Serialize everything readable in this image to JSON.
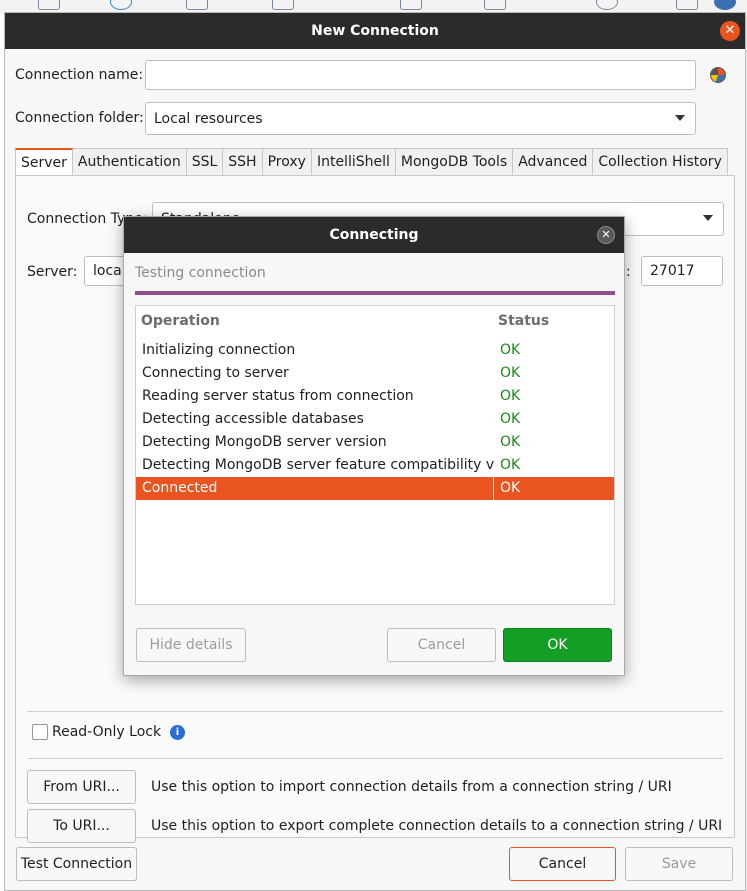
{
  "window": {
    "title": "New Connection"
  },
  "form": {
    "connection_name_label": "Connection name:",
    "connection_name_value": "",
    "connection_folder_label": "Connection folder:",
    "connection_folder_value": "Local resources"
  },
  "tabs": [
    {
      "label": "Server",
      "active": true
    },
    {
      "label": "Authentication"
    },
    {
      "label": "SSL"
    },
    {
      "label": "SSH"
    },
    {
      "label": "Proxy"
    },
    {
      "label": "IntelliShell"
    },
    {
      "label": "MongoDB Tools"
    },
    {
      "label": "Advanced"
    },
    {
      "label": "Collection History"
    }
  ],
  "server_tab": {
    "connection_type_label": "Connection Type:",
    "connection_type_value": "Standalone",
    "server_label": "Server:",
    "server_value_visible": "local",
    "port_colon": ":",
    "port_value": "27017",
    "read_only_lock_label": "Read-Only Lock",
    "from_uri_button": "From URI...",
    "from_uri_desc": "Use this option to import connection details from a connection string / URI",
    "to_uri_button": "To URI...",
    "to_uri_desc": "Use this option to export complete connection details to a connection string / URI"
  },
  "footer": {
    "test_connection": "Test Connection",
    "cancel": "Cancel",
    "save": "Save"
  },
  "connecting_dialog": {
    "title": "Connecting",
    "status": "Testing connection",
    "progress": 1.0,
    "columns": [
      "Operation",
      "Status"
    ],
    "rows": [
      {
        "operation": "Initializing connection",
        "status": "OK"
      },
      {
        "operation": "Connecting to server",
        "status": "OK"
      },
      {
        "operation": "Reading server status from connection",
        "status": "OK"
      },
      {
        "operation": "Detecting accessible databases",
        "status": "OK"
      },
      {
        "operation": "Detecting MongoDB server version",
        "status": "OK"
      },
      {
        "operation": "Detecting MongoDB server feature compatibility version",
        "status": "OK"
      },
      {
        "operation": "Connected",
        "status": "OK",
        "selected": true
      }
    ],
    "hide_details": "Hide details",
    "cancel": "Cancel",
    "ok": "OK"
  },
  "colors": {
    "accent": "#e95420",
    "ok_green": "#139e25",
    "progress": "#924d8b",
    "titlebar": "#2b2b2b"
  }
}
